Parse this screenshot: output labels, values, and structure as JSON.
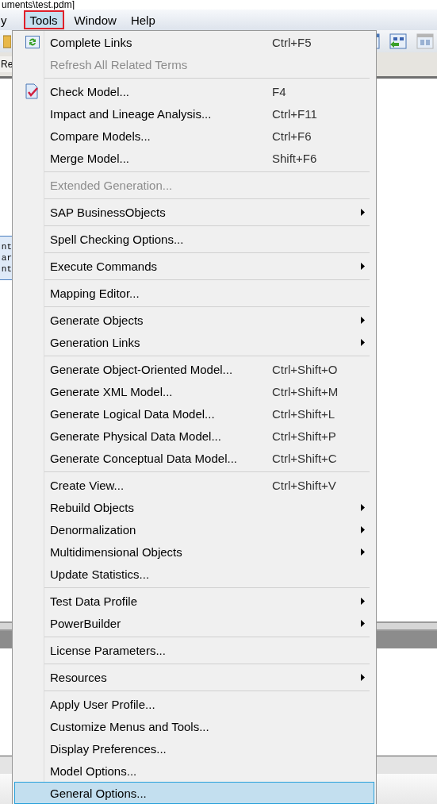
{
  "title_fragment": "uments\\test.pdm]",
  "menubar": [
    {
      "label": "y",
      "selected": false
    },
    {
      "label": "Tools",
      "selected": true
    },
    {
      "label": "Window",
      "selected": false
    },
    {
      "label": "Help",
      "selected": false
    }
  ],
  "background": {
    "tab_fragment": "Re",
    "diagram_lines": [
      "nt",
      "ar",
      "nt"
    ]
  },
  "menu": {
    "groups": [
      [
        {
          "label": "Complete Links",
          "shortcut": "Ctrl+F5",
          "submenu": false,
          "disabled": false,
          "selected": false
        },
        {
          "label": "Refresh All Related Terms",
          "submenu": false,
          "disabled": true,
          "selected": false
        }
      ],
      [
        {
          "label": "Check Model...",
          "shortcut": "F4",
          "submenu": false,
          "disabled": false,
          "selected": false
        },
        {
          "label": "Impact and Lineage Analysis...",
          "shortcut": "Ctrl+F11",
          "submenu": false,
          "disabled": false,
          "selected": false
        },
        {
          "label": "Compare Models...",
          "shortcut": "Ctrl+F6",
          "submenu": false,
          "disabled": false,
          "selected": false
        },
        {
          "label": "Merge Model...",
          "shortcut": "Shift+F6",
          "submenu": false,
          "disabled": false,
          "selected": false
        }
      ],
      [
        {
          "label": "Extended Generation...",
          "submenu": false,
          "disabled": true,
          "selected": false
        }
      ],
      [
        {
          "label": "SAP BusinessObjects",
          "submenu": true,
          "disabled": false,
          "selected": false
        }
      ],
      [
        {
          "label": "Spell Checking Options...",
          "submenu": false,
          "disabled": false,
          "selected": false
        }
      ],
      [
        {
          "label": "Execute Commands",
          "submenu": true,
          "disabled": false,
          "selected": false
        }
      ],
      [
        {
          "label": "Mapping Editor...",
          "submenu": false,
          "disabled": false,
          "selected": false
        }
      ],
      [
        {
          "label": "Generate Objects",
          "submenu": true,
          "disabled": false,
          "selected": false
        },
        {
          "label": "Generation Links",
          "submenu": true,
          "disabled": false,
          "selected": false
        }
      ],
      [
        {
          "label": "Generate Object-Oriented Model...",
          "shortcut": "Ctrl+Shift+O",
          "submenu": false,
          "disabled": false,
          "selected": false
        },
        {
          "label": "Generate XML Model...",
          "shortcut": "Ctrl+Shift+M",
          "submenu": false,
          "disabled": false,
          "selected": false
        },
        {
          "label": "Generate Logical Data Model...",
          "shortcut": "Ctrl+Shift+L",
          "submenu": false,
          "disabled": false,
          "selected": false
        },
        {
          "label": "Generate Physical Data Model...",
          "shortcut": "Ctrl+Shift+P",
          "submenu": false,
          "disabled": false,
          "selected": false
        },
        {
          "label": "Generate Conceptual Data Model...",
          "shortcut": "Ctrl+Shift+C",
          "submenu": false,
          "disabled": false,
          "selected": false
        }
      ],
      [
        {
          "label": "Create View...",
          "shortcut": "Ctrl+Shift+V",
          "submenu": false,
          "disabled": false,
          "selected": false
        },
        {
          "label": "Rebuild Objects",
          "submenu": true,
          "disabled": false,
          "selected": false
        },
        {
          "label": "Denormalization",
          "submenu": true,
          "disabled": false,
          "selected": false
        },
        {
          "label": "Multidimensional Objects",
          "submenu": true,
          "disabled": false,
          "selected": false
        },
        {
          "label": "Update Statistics...",
          "submenu": false,
          "disabled": false,
          "selected": false
        }
      ],
      [
        {
          "label": "Test Data Profile",
          "submenu": true,
          "disabled": false,
          "selected": false
        },
        {
          "label": "PowerBuilder",
          "submenu": true,
          "disabled": false,
          "selected": false
        }
      ],
      [
        {
          "label": "License Parameters...",
          "submenu": false,
          "disabled": false,
          "selected": false
        }
      ],
      [
        {
          "label": "Resources",
          "submenu": true,
          "disabled": false,
          "selected": false
        }
      ],
      [
        {
          "label": "Apply User Profile...",
          "submenu": false,
          "disabled": false,
          "selected": false
        },
        {
          "label": "Customize Menus and Tools...",
          "submenu": false,
          "disabled": false,
          "selected": false
        },
        {
          "label": "Display Preferences...",
          "submenu": false,
          "disabled": false,
          "selected": false
        },
        {
          "label": "Model Options...",
          "submenu": false,
          "disabled": false,
          "selected": false
        },
        {
          "label": "General Options...",
          "submenu": false,
          "disabled": false,
          "selected": true
        }
      ]
    ]
  }
}
